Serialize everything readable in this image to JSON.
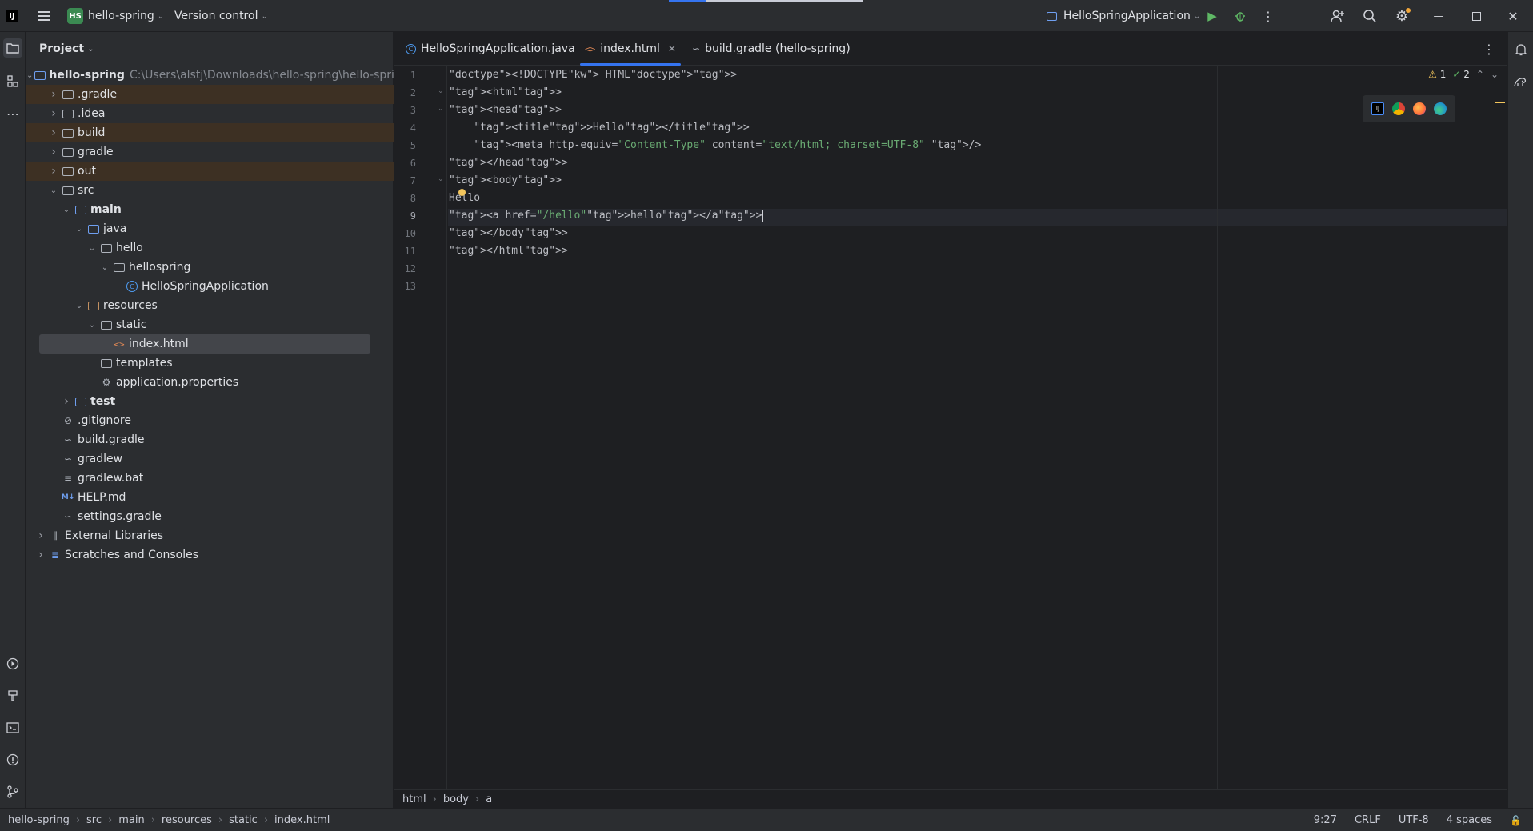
{
  "titlebar": {
    "app_logo": "IJ",
    "project_badge": "HS",
    "project_name": "hello-spring",
    "vcs_label": "Version control",
    "run_config": "HelloSpringApplication",
    "icons": [
      "main-menu-icon",
      "run-icon",
      "debug-icon",
      "more-icon",
      "add-user-icon",
      "search-icon",
      "settings-icon",
      "minimize-icon",
      "restore-icon",
      "close-icon"
    ]
  },
  "project_panel": {
    "title": "Project",
    "tree": [
      {
        "label": "hello-spring",
        "path": "C:\\Users\\alstj\\Downloads\\hello-spring\\hello-spring",
        "depth": 0,
        "expanded": true,
        "icon": "module-folder-icon",
        "bold": true
      },
      {
        "label": ".gradle",
        "depth": 1,
        "expanded": false,
        "icon": "folder-icon",
        "excluded": true
      },
      {
        "label": ".idea",
        "depth": 1,
        "expanded": false,
        "icon": "folder-icon"
      },
      {
        "label": "build",
        "depth": 1,
        "expanded": false,
        "icon": "folder-icon",
        "excluded": true
      },
      {
        "label": "gradle",
        "depth": 1,
        "expanded": false,
        "icon": "folder-icon"
      },
      {
        "label": "out",
        "depth": 1,
        "expanded": false,
        "icon": "folder-icon",
        "excluded": true
      },
      {
        "label": "src",
        "depth": 1,
        "expanded": true,
        "icon": "folder-icon"
      },
      {
        "label": "main",
        "depth": 2,
        "expanded": true,
        "icon": "module-folder-icon",
        "bold": true
      },
      {
        "label": "java",
        "depth": 3,
        "expanded": true,
        "icon": "source-folder-icon"
      },
      {
        "label": "hello",
        "depth": 4,
        "expanded": true,
        "icon": "package-icon"
      },
      {
        "label": "hellospring",
        "depth": 5,
        "expanded": true,
        "icon": "package-icon"
      },
      {
        "label": "HelloSpringApplication",
        "depth": 6,
        "icon": "class-icon"
      },
      {
        "label": "resources",
        "depth": 3,
        "expanded": true,
        "icon": "resources-folder-icon"
      },
      {
        "label": "static",
        "depth": 4,
        "expanded": true,
        "icon": "folder-icon"
      },
      {
        "label": "index.html",
        "depth": 5,
        "icon": "html-file-icon",
        "selected": true
      },
      {
        "label": "templates",
        "depth": 4,
        "icon": "folder-icon"
      },
      {
        "label": "application.properties",
        "depth": 4,
        "icon": "properties-icon"
      },
      {
        "label": "test",
        "depth": 2,
        "expanded": false,
        "icon": "module-folder-icon",
        "bold": true
      },
      {
        "label": ".gitignore",
        "depth": 1,
        "icon": "gitignore-icon"
      },
      {
        "label": "build.gradle",
        "depth": 1,
        "icon": "gradle-icon"
      },
      {
        "label": "gradlew",
        "depth": 1,
        "icon": "gradle-icon"
      },
      {
        "label": "gradlew.bat",
        "depth": 1,
        "icon": "text-file-icon"
      },
      {
        "label": "HELP.md",
        "depth": 1,
        "icon": "markdown-icon"
      },
      {
        "label": "settings.gradle",
        "depth": 1,
        "icon": "gradle-icon"
      },
      {
        "label": "External Libraries",
        "depth": 0,
        "expanded": false,
        "icon": "libraries-icon"
      },
      {
        "label": "Scratches and Consoles",
        "depth": 0,
        "expanded": false,
        "icon": "scratches-icon"
      }
    ]
  },
  "tabs": [
    {
      "label": "HelloSpringApplication.java",
      "icon": "class-icon",
      "active": false
    },
    {
      "label": "index.html",
      "icon": "html-file-icon",
      "active": true,
      "closable": true
    },
    {
      "label": "build.gradle (hello-spring)",
      "icon": "gradle-icon",
      "active": false
    }
  ],
  "editor": {
    "lines": [
      {
        "n": "1",
        "code": "<!DOCTYPE HTML>"
      },
      {
        "n": "2",
        "code": "<html>"
      },
      {
        "n": "3",
        "code": "<head>"
      },
      {
        "n": "4",
        "code": "    <title>Hello</title>"
      },
      {
        "n": "5",
        "code": "    <meta http-equiv=\"Content-Type\" content=\"text/html; charset=UTF-8\" />"
      },
      {
        "n": "6",
        "code": "</head>"
      },
      {
        "n": "7",
        "code": "<body>"
      },
      {
        "n": "8",
        "code": "Hello"
      },
      {
        "n": "9",
        "code": "<a href=\"/hello\">hello</a>"
      },
      {
        "n": "10",
        "code": "</body>"
      },
      {
        "n": "11",
        "code": "</html>"
      },
      {
        "n": "12",
        "code": ""
      },
      {
        "n": "13",
        "code": ""
      }
    ],
    "current_line": 9,
    "warnings": "1",
    "ok_count": "2"
  },
  "breadcrumb": [
    "html",
    "body",
    "a"
  ],
  "statusbar": {
    "path": [
      "hello-spring",
      "src",
      "main",
      "resources",
      "static",
      "index.html"
    ],
    "position": "9:27",
    "line_ending": "CRLF",
    "encoding": "UTF-8",
    "indent": "4 spaces"
  },
  "colors": {
    "accent": "#3574f0",
    "background": "#1e1f22",
    "panel": "#2b2d30",
    "excluded_row": "#3d3023",
    "tag": "#d5b778",
    "string": "#6aab73"
  }
}
